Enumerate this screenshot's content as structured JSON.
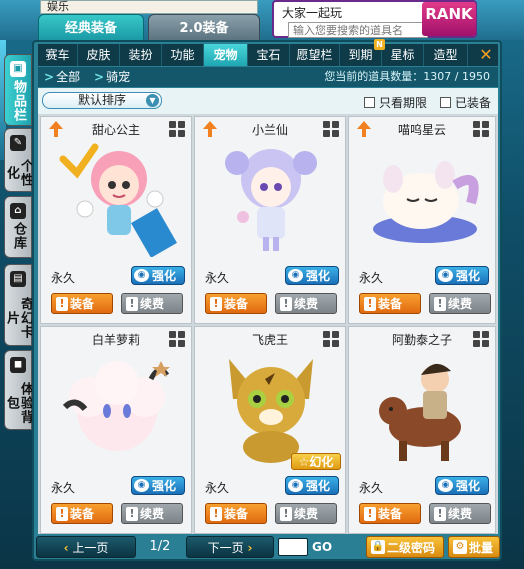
{
  "top": {
    "entertainment_label": "娱乐",
    "chat_title": "大家一起玩",
    "search_placeholder": "输入您要搜索的道具名",
    "rank_label": "RANK",
    "tabs": [
      "经典装备",
      "2.0装备"
    ]
  },
  "side_tabs": [
    {
      "label": "物品栏",
      "icon": "box-icon",
      "active": true
    },
    {
      "label": "个性化",
      "icon": "brush-icon",
      "active": false
    },
    {
      "label": "仓库",
      "icon": "house-icon",
      "active": false
    },
    {
      "label": "奇幻卡片",
      "icon": "card-icon",
      "active": false
    },
    {
      "label": "体验背包",
      "icon": "bag-icon",
      "active": false
    }
  ],
  "categories": [
    "赛车",
    "皮肤",
    "装扮",
    "功能",
    "宠物",
    "宝石",
    "愿望栏",
    "到期",
    "星标",
    "造型"
  ],
  "active_category": "宠物",
  "expiring_badge": "N",
  "breadcrumb": [
    "全部",
    "骑宠"
  ],
  "item_count_label": "您当前的道具数量：1307 / 1950",
  "sort_label": "默认排序",
  "filters": [
    "只看期限",
    "已装备"
  ],
  "items": [
    {
      "name": "甜心公主",
      "duration": "永久",
      "upgrade": true,
      "special": ""
    },
    {
      "name": "小兰仙",
      "duration": "永久",
      "upgrade": true,
      "special": ""
    },
    {
      "name": "喵呜星云",
      "duration": "永久",
      "upgrade": true,
      "special": ""
    },
    {
      "name": "白羊萝莉",
      "duration": "永久",
      "upgrade": false,
      "special": ""
    },
    {
      "name": "飞虎王",
      "duration": "永久",
      "upgrade": false,
      "special": "幻化"
    },
    {
      "name": "阿勤泰之子",
      "duration": "永久",
      "upgrade": false,
      "special": ""
    }
  ],
  "item_actions": {
    "enhance": "强化",
    "equip": "装备",
    "renew": "续费"
  },
  "pagination": {
    "prev": "上一页",
    "next": "下一页",
    "page": "1/2",
    "go": "GO"
  },
  "bottom_buttons": {
    "second_password": "二级密码",
    "batch": "批量"
  },
  "colors": {
    "accent": "#1fa6b2",
    "panel": "#2a7f95",
    "equip": "#e06a10",
    "enhance": "#1a70b8"
  }
}
